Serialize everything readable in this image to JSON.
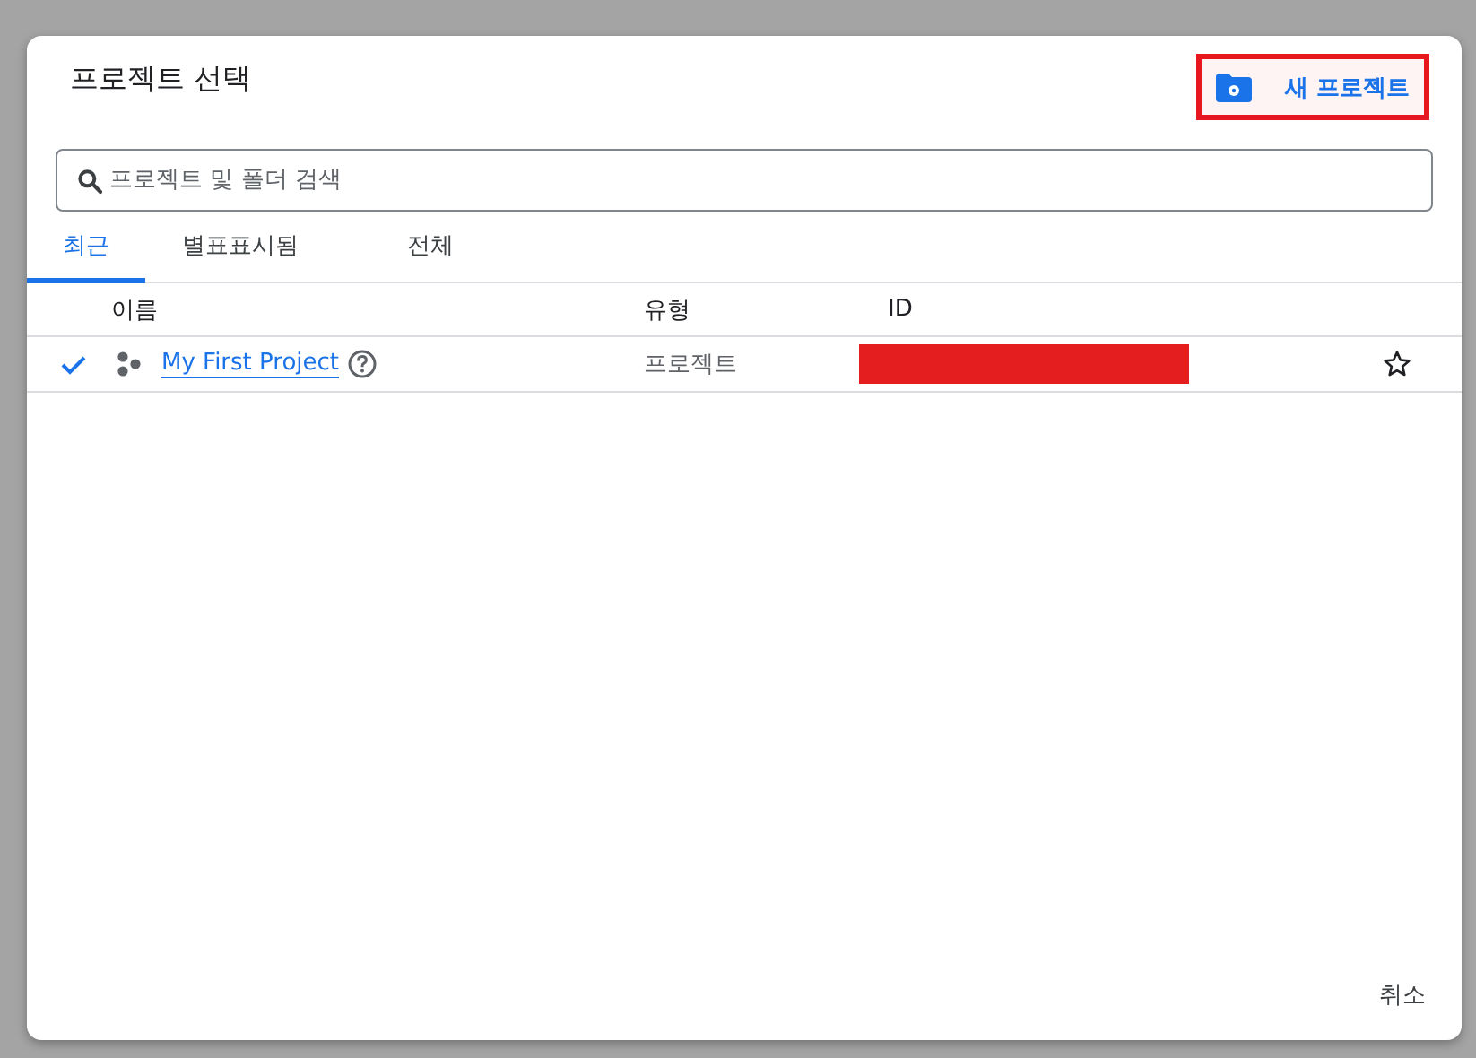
{
  "dialog": {
    "title": "프로젝트 선택",
    "new_project_button": {
      "label": "새 프로젝트",
      "highlighted": true
    },
    "search": {
      "placeholder": "프로젝트 및 폴더 검색"
    },
    "tabs": [
      {
        "label": "최근",
        "selected": true
      },
      {
        "label": "별표표시됨",
        "selected": false
      },
      {
        "label": "전체",
        "selected": false
      }
    ],
    "table": {
      "columns": [
        "이름",
        "유형",
        "ID"
      ],
      "rows": [
        {
          "selected": true,
          "name": "My First Project",
          "type": "프로젝트",
          "id_redacted": true,
          "starred": false
        }
      ]
    },
    "buttons": [
      "취소"
    ]
  }
}
